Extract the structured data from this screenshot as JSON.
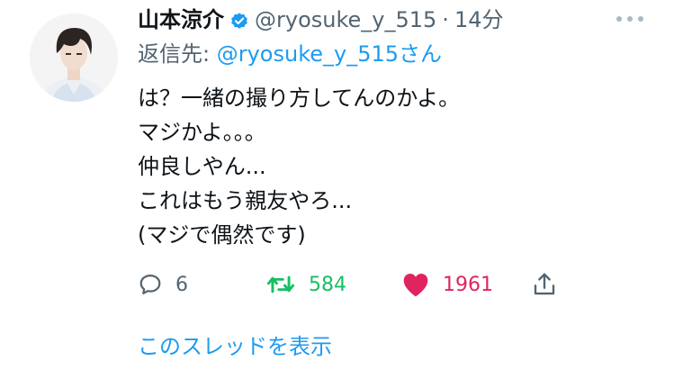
{
  "author": {
    "display_name": "山本涼介",
    "handle": "@ryosuke_y_515",
    "separator": "·",
    "time": "14分",
    "verified_icon": "verified-badge-icon"
  },
  "reply": {
    "prefix": "返信先: ",
    "mention": "@ryosuke_y_515さん"
  },
  "tweet": {
    "lines": [
      "は？一緒の撮り方してんのかよ。",
      "マジかよ。。。",
      "仲良しやん...",
      "これはもう親友やろ...",
      "(マジで偶然です)"
    ]
  },
  "actions": {
    "reply_count": "6",
    "retweet_count": "584",
    "like_count": "1961",
    "reply_icon": "speech-bubble-icon",
    "retweet_icon": "retweet-arrows-icon",
    "like_icon": "heart-icon",
    "share_icon": "share-upload-icon"
  },
  "show_thread": "このスレッドを表示",
  "colors": {
    "link_blue": "#1d9bf0",
    "retweet_green": "#17bf63",
    "like_pink": "#e0245e",
    "muted_gray": "#536471"
  }
}
